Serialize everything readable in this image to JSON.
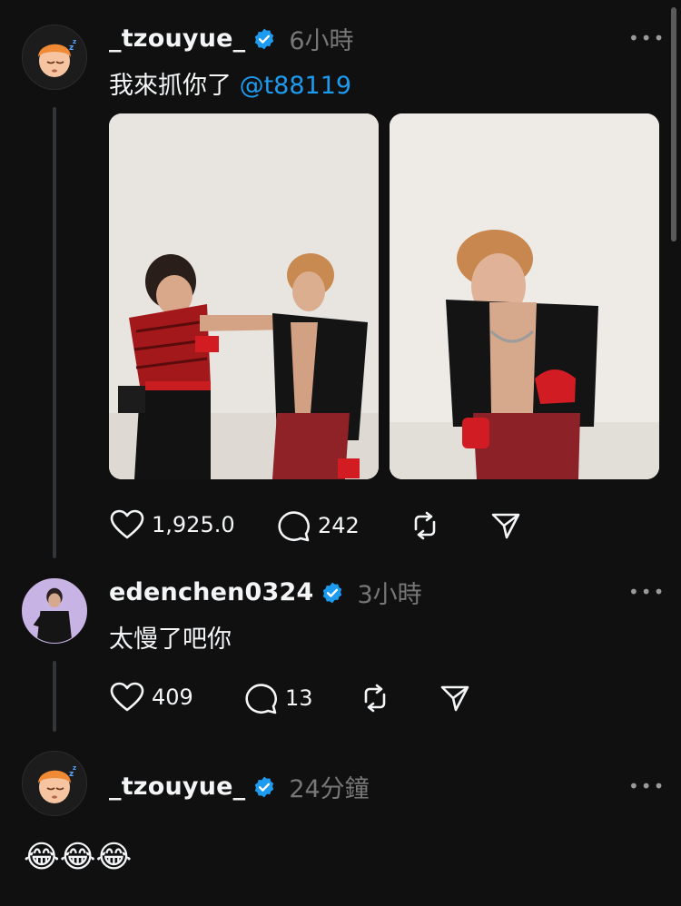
{
  "posts": [
    {
      "username": "_tzouyue_",
      "time": "6小時",
      "text": "我來抓你了 ",
      "mention": "@t88119",
      "stats": {
        "likes": "1,925.0",
        "replies": "242"
      },
      "avatar_icon": "memoji-sleeping-avatar"
    },
    {
      "username": "edenchen0324",
      "time": "3小時",
      "text": "太慢了吧你",
      "stats": {
        "likes": "409",
        "replies": "13"
      },
      "avatar_icon": "profile-photo-avatar"
    },
    {
      "username": "_tzouyue_",
      "time": "24分鐘",
      "text": "😂😂😂",
      "avatar_icon": "memoji-sleeping-avatar"
    }
  ],
  "icons": {
    "like": "heart-icon",
    "reply": "comment-icon",
    "repost": "repost-icon",
    "share": "send-icon",
    "more": "more-options-icon",
    "verified": "verified-badge-icon"
  },
  "colors": {
    "background": "#101010",
    "text": "#f3f5f7",
    "muted": "#777777",
    "link": "#1d9bf0",
    "verified": "#1d9bf0"
  }
}
